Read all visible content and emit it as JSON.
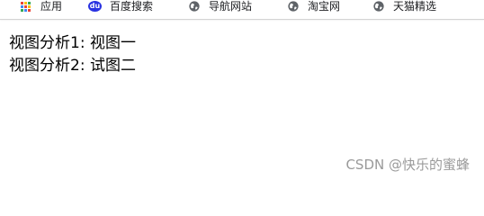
{
  "bookmarks": [
    {
      "label": "应用",
      "icon": "apps-grid-icon"
    },
    {
      "label": "百度搜索",
      "icon": "baidu-icon",
      "icon_text": "du"
    },
    {
      "label": "导航网站",
      "icon": "globe-icon"
    },
    {
      "label": "淘宝网",
      "icon": "globe-icon"
    },
    {
      "label": "天猫精选",
      "icon": "globe-icon"
    }
  ],
  "content": {
    "line1": "视图分析1: 视图一",
    "line2": "视图分析2: 试图二"
  },
  "watermark": "CSDN @快乐的蜜蜂",
  "colors": {
    "apps_grid": [
      "#ea4335",
      "#fbbc05",
      "#34a853",
      "#4285f4",
      "#ea4335",
      "#fbbc05",
      "#34a853",
      "#4285f4",
      "#ea4335"
    ],
    "baidu": "#2932e1",
    "globe": "#5f6368",
    "text": "#000000",
    "watermark": "#9a9a9a"
  }
}
